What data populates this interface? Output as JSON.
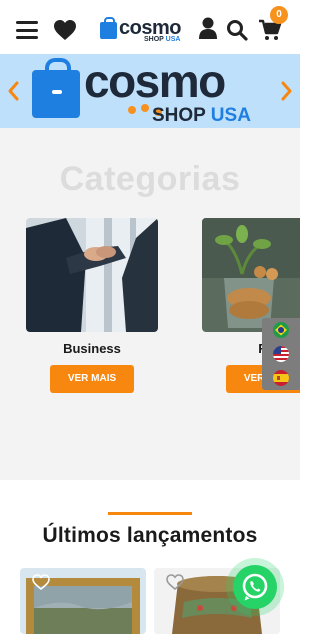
{
  "header": {
    "logo_brand": "cosmo",
    "logo_sub_1": "SHOP",
    "logo_sub_2": "USA",
    "cart_count": "0",
    "icons": [
      "menu-icon",
      "heart-icon",
      "user-icon",
      "search-icon",
      "cart-icon"
    ]
  },
  "banner": {
    "brand": "cosmo",
    "sub_1": "SHOP",
    "sub_2": "USA",
    "icons": [
      "chevron-left-icon",
      "chevron-right-icon"
    ]
  },
  "categories": {
    "title": "Categorias",
    "items": [
      {
        "label": "Business",
        "button": "VER MAIS"
      },
      {
        "label": "Fin",
        "button": "VER MAIS"
      }
    ]
  },
  "languages": [
    "brazil-flag-icon",
    "usa-flag-icon",
    "spain-flag-icon"
  ],
  "latest": {
    "title": "Últimos lançamentos"
  },
  "colors": {
    "accent_orange": "#f7870f",
    "brand_blue": "#1f7fe0",
    "banner_bg": "#bfe0fb",
    "whatsapp_green": "#25d366"
  }
}
